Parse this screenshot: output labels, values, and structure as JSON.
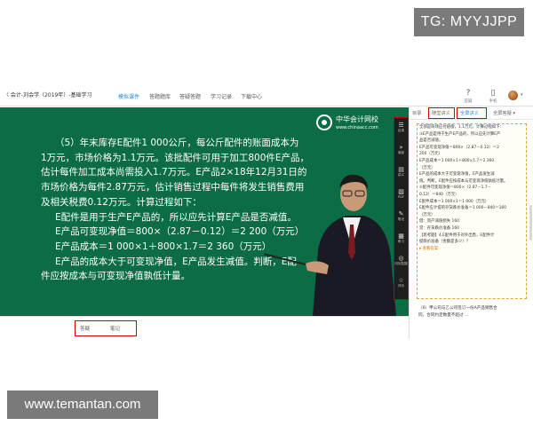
{
  "watermarks": {
    "top": "TG: MYYJJPP",
    "bottom": "www.temantan.com"
  },
  "topbar": {
    "title": "〈 会计-刘会学（2019年）-基础学习",
    "nav": [
      "模拟课件",
      "答题题库",
      "答疑答题",
      "学习记录",
      "下载中心"
    ],
    "icons": [
      {
        "icon": "question-icon",
        "label": "答疑"
      },
      {
        "icon": "phone-icon",
        "label": "手机"
      }
    ],
    "avatar_caret": "▾"
  },
  "video": {
    "logo_name": "中华会计网校",
    "logo_url": "www.chinaacc.com",
    "lines": [
      "（5）年末库存E配件1 000公斤，每公斤配件的账面成本为",
      "1万元，市场价格为1.1万元。该批配件可用于加工800件E产品，",
      "估计每件加工成本尚需投入1.7万元。E产品2×18年12月31日的",
      "市场价格为每件2.87万元，估计销售过程中每件将发生销售费用",
      "及相关税费0.12万元。计算过程如下：",
      "E配件是用于生产E产品的，所以应先计算E产品是否减值。",
      "E产品可变现净值＝800×（2.87－0.12）＝2 200（万元）",
      "E产品成本＝1 000×1＋800×1.7＝2 360（万元）",
      "E产品的成本大于可变现净值，E产品发生减值。判断，E配",
      "件应按成本与可变现净值孰低计量。"
    ]
  },
  "toolbar": [
    {
      "icon": "list-icon",
      "label": "目录"
    },
    {
      "icon": "collapse-icon",
      "label": "收起"
    },
    {
      "icon": "handout-icon",
      "label": "讲义"
    },
    {
      "icon": "pdf-icon",
      "label": "PDF"
    },
    {
      "icon": "note-icon",
      "label": "笔记"
    },
    {
      "icon": "practice-icon",
      "label": "练习"
    },
    {
      "icon": "qa-icon",
      "label": "问问答疑"
    },
    {
      "icon": "star-icon",
      "label": "评价"
    }
  ],
  "side": {
    "tabs": [
      "目录",
      "随堂讲义",
      "全屏讲义",
      "全屏答疑 ▾"
    ],
    "notes": [
      "全部是商场应付赔偿，1.1万元，计算过程如下：",
      "  ③E产品是用于生产E产品的，所以应先计算E产",
      "品是否减值。",
      "  E产品可变现净值＝800×（2.87－0.12）＝2",
      "200（万元）",
      "  E产品成本＝1 000×1＋800×1.7＝2 360",
      "（万元）",
      "  E产品的成本大于可变现净值，E产品发生减",
      "值。判断，E配件应按成本与可变现净值孰低计量。",
      "  ②配件可变现净值＝800×（2.87－1.7－",
      "0.12）＝840（万元）",
      "  E配件成本＝1 000×1＝1 000（万元）",
      "  E配件应计提的存货跌价准备＝1 000－840＝160",
      "（万元）",
      "  借：资产减值损失                160",
      "    贷：存货跌价准备                 160",
      "【思考题】4.E配件用于对外出售，E配件计",
      "提跌价准备（金额是多少）？",
      "  ▸ 查看答案"
    ],
    "footer": [
      "（6）甲公司与乙公司签订一份A产品销售合",
      "同，合同约定数量不超过 ..."
    ]
  },
  "bottom": {
    "tabs": [
      "答疑",
      "笔记"
    ]
  }
}
